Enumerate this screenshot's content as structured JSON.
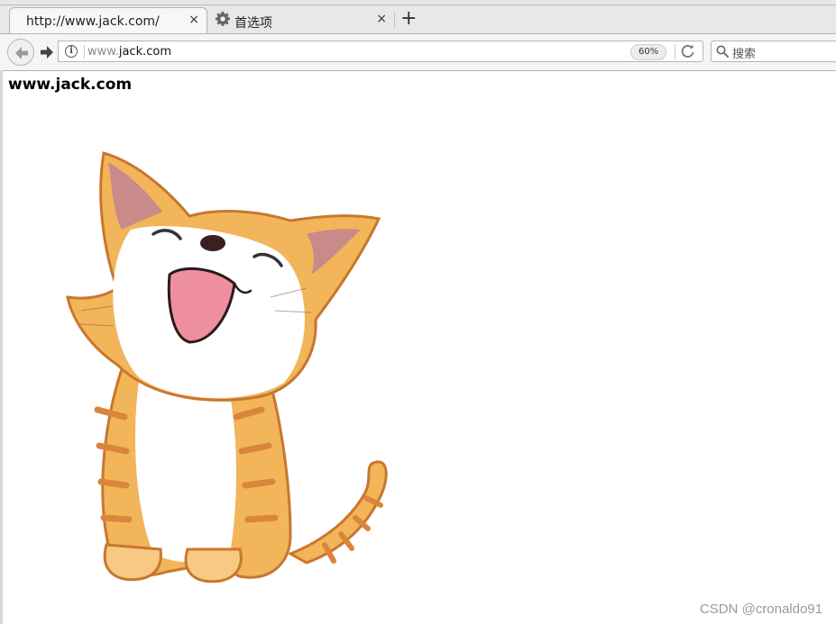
{
  "tabs": [
    {
      "title": "http://www.jack.com/",
      "active": true
    },
    {
      "title": "首选项",
      "active": false
    }
  ],
  "new_tab_label": "+",
  "close_glyph": "×",
  "address_bar": {
    "prefix": "www.",
    "domain": "jack.com",
    "zoom": "60%"
  },
  "search": {
    "placeholder": "搜索"
  },
  "page": {
    "heading": "www.jack.com"
  },
  "watermark": "CSDN @cronaldo91",
  "icons": [
    "back-arrow-icon",
    "forward-arrow-icon",
    "info-icon",
    "reload-icon",
    "search-icon",
    "gear-icon"
  ],
  "colors": {
    "cat_orange": "#f2b55a",
    "cat_stripe": "#d9853b",
    "ear_pink": "#c98a8a",
    "mouth_pink": "#ee8fa0"
  }
}
